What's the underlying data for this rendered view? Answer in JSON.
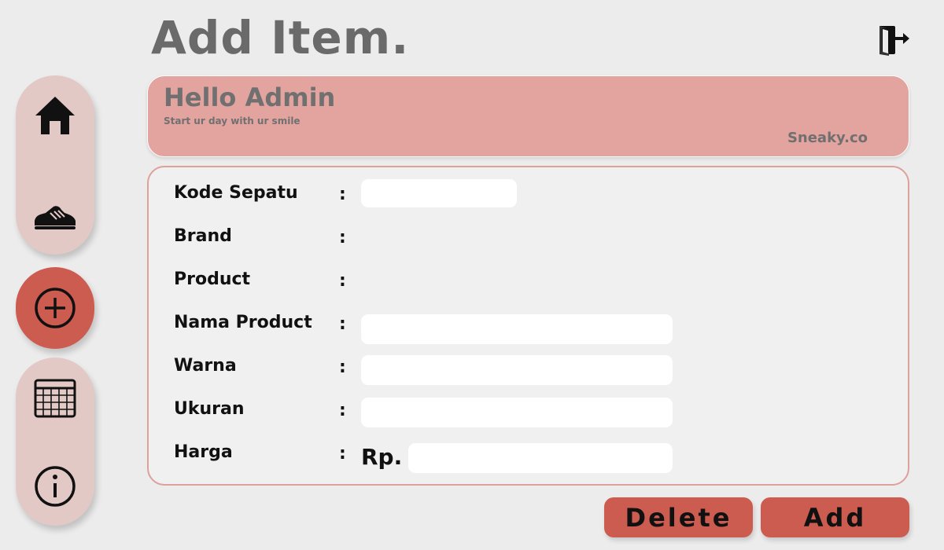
{
  "page": {
    "title": "Add Item."
  },
  "header_card": {
    "greeting": "Hello Admin",
    "subtitle": "Start ur day with ur smile",
    "brand": "Sneaky.co"
  },
  "sidebar": {
    "items": [
      {
        "name": "home",
        "icon": "home-icon"
      },
      {
        "name": "products",
        "icon": "sneaker-icon"
      },
      {
        "name": "add",
        "icon": "plus-circle-icon",
        "active": true
      },
      {
        "name": "table",
        "icon": "table-icon"
      },
      {
        "name": "info",
        "icon": "info-icon"
      }
    ]
  },
  "form": {
    "fields": [
      {
        "label": "Kode Sepatu",
        "value": ""
      },
      {
        "label": "Brand",
        "value": ""
      },
      {
        "label": "Product",
        "value": ""
      },
      {
        "label": "Nama Product",
        "value": ""
      },
      {
        "label": "Warna",
        "value": ""
      },
      {
        "label": "Ukuran",
        "value": ""
      },
      {
        "label": "Harga",
        "value": ""
      }
    ],
    "separator": ":",
    "currency_prefix": "Rp."
  },
  "actions": {
    "delete_label": "Delete",
    "add_label": "Add"
  },
  "colors": {
    "background": "#ececec",
    "sidebar_pill": "#e3c9c6",
    "accent": "#cd5c50",
    "header_card": "#e3a39e",
    "form_border": "#dea09b"
  }
}
